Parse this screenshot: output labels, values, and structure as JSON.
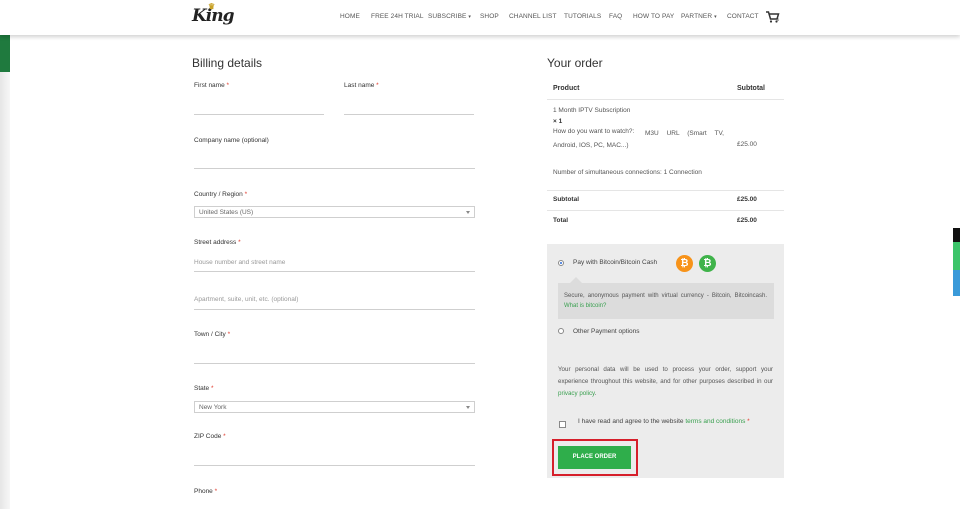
{
  "header": {
    "logo_text": "King",
    "nav": [
      {
        "label": "HOME",
        "dropdown": false
      },
      {
        "label": "FREE 24H TRIAL",
        "dropdown": false
      },
      {
        "label": "SUBSCRIBE",
        "dropdown": true
      },
      {
        "label": "SHOP",
        "dropdown": false
      },
      {
        "label": "CHANNEL LIST",
        "dropdown": false
      },
      {
        "label": "TUTORIALS",
        "dropdown": false
      },
      {
        "label": "FAQ",
        "dropdown": false
      },
      {
        "label": "HOW TO PAY",
        "dropdown": false
      },
      {
        "label": "PARTNER",
        "dropdown": true
      },
      {
        "label": "CONTACT",
        "dropdown": false
      }
    ],
    "cart_count": "0"
  },
  "billing": {
    "title": "Billing details",
    "first_name_label": "First name",
    "last_name_label": "Last name",
    "company_label": "Company name (optional)",
    "country_label": "Country / Region",
    "country_value": "United States (US)",
    "street_label": "Street address",
    "street_placeholder": "House number and street name",
    "apartment_placeholder": "Apartment, suite, unit, etc. (optional)",
    "city_label": "Town / City",
    "state_label": "State",
    "state_value": "New York",
    "zip_label": "ZIP Code",
    "phone_label": "Phone",
    "required_mark": "*"
  },
  "order": {
    "title": "Your order",
    "col_product": "Product",
    "col_subtotal": "Subtotal",
    "item_name": "1 Month IPTV Subscription",
    "item_qty": "× 1",
    "watch_label": "How do you want to watch?:",
    "watch_value": "M3U URL (Smart TV, Android, IOS, PC, MAC...)",
    "connections_label": "Number of simultaneous connections:",
    "connections_value": "1 Connection",
    "item_price": "£25.00",
    "subtotal_label": "Subtotal",
    "subtotal_value": "£25.00",
    "total_label": "Total",
    "total_value": "£25.00"
  },
  "payment": {
    "bitcoin_label": "Pay with Bitcoin/Bitcoin Cash",
    "bitcoin_desc": "Secure, anonymous payment with virtual currency - Bitcoin, Bitcoincash.",
    "bitcoin_link": "What is bitcoin?",
    "other_label": "Other Payment options",
    "privacy_text": "Your personal data will be used to process your order, support your experience throughout this website, and for other purposes described in our",
    "privacy_link": "privacy policy",
    "terms_text": "I have read and agree to the website",
    "terms_link": "terms and conditions",
    "place_order": "Place order",
    "selected": "bitcoin"
  },
  "colors": {
    "brand_green": "#2fae4b",
    "highlight_red": "#d61f2b",
    "bitcoin_orange": "#f7931a",
    "bitcoin_cash_green": "#3fb34a"
  }
}
